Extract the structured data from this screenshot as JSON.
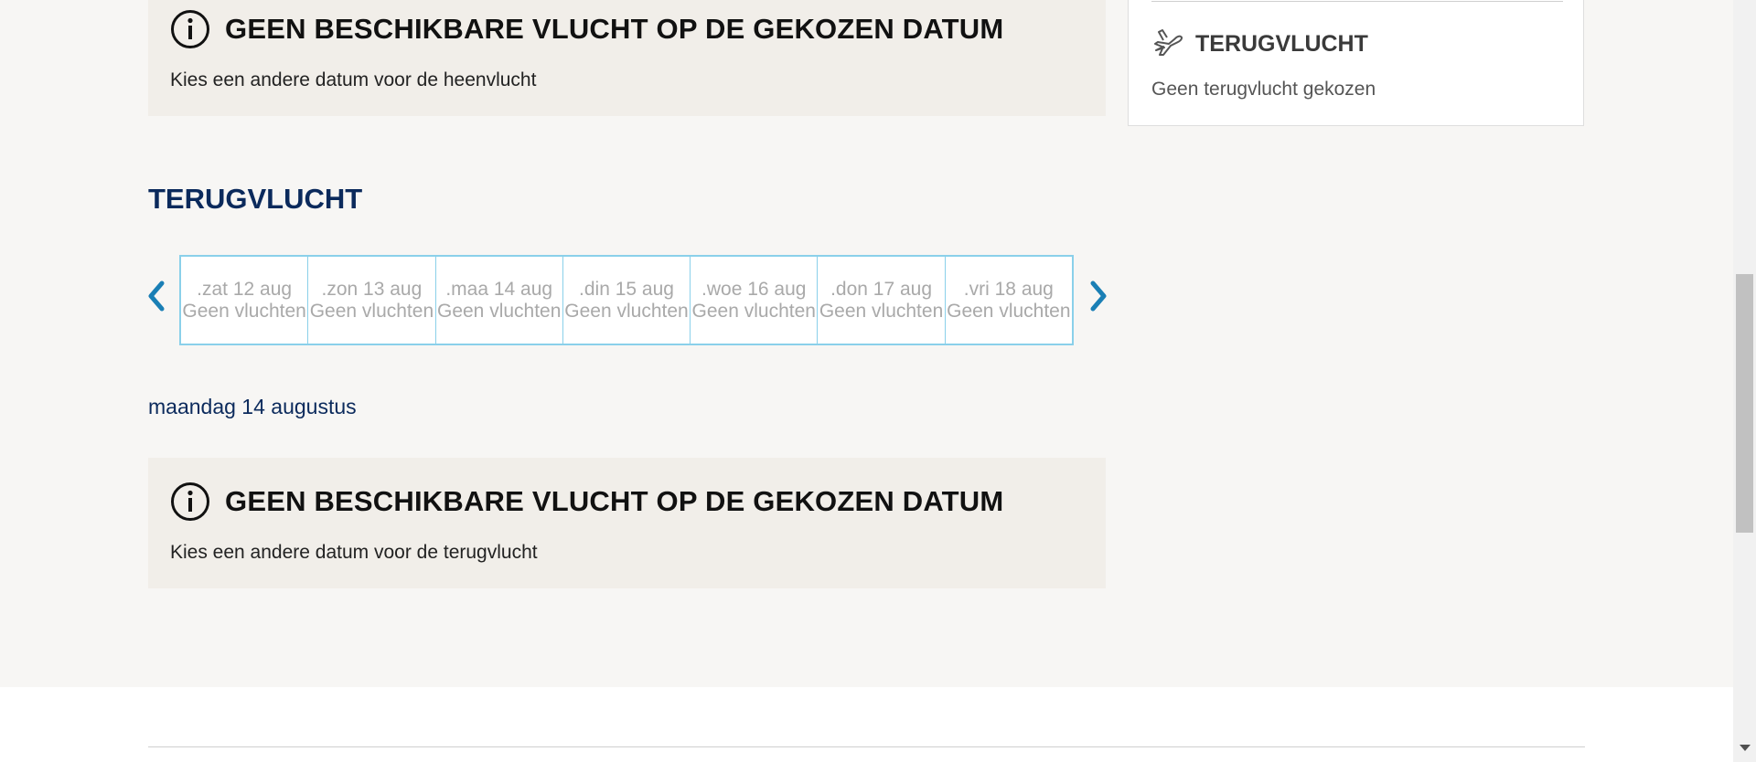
{
  "outbound_notice": {
    "title": "GEEN BESCHIKBARE VLUCHT OP DE GEKOZEN DATUM",
    "text": "Kies een andere datum voor de heenvlucht",
    "icon": "info-circle-icon"
  },
  "summary_panel": {
    "title": "TERUGVLUCHT",
    "text": "Geen terugvlucht gekozen",
    "icon": "plane-icon"
  },
  "return_section": {
    "heading": "TERUGVLUCHT",
    "prev_icon": "chevron-left-icon",
    "next_icon": "chevron-right-icon",
    "dates": [
      {
        "label": ".zat 12 aug",
        "status": "Geen vluchten"
      },
      {
        "label": ".zon 13 aug",
        "status": "Geen vluchten"
      },
      {
        "label": ".maa 14 aug",
        "status": "Geen vluchten"
      },
      {
        "label": ".din 15 aug",
        "status": "Geen vluchten"
      },
      {
        "label": ".woe 16 aug",
        "status": "Geen vluchten"
      },
      {
        "label": ".don 17 aug",
        "status": "Geen vluchten"
      },
      {
        "label": ".vri 18 aug",
        "status": "Geen vluchten"
      }
    ],
    "selected_date": "maandag 14 augustus"
  },
  "return_notice": {
    "title": "GEEN BESCHIKBARE VLUCHT OP DE GEKOZEN DATUM",
    "text": "Kies een andere datum voor de terugvlucht",
    "icon": "info-circle-icon"
  },
  "colors": {
    "accent_blue": "#1a7fb5",
    "heading_navy": "#0b2a5c",
    "strip_border": "#8ad0ea"
  }
}
